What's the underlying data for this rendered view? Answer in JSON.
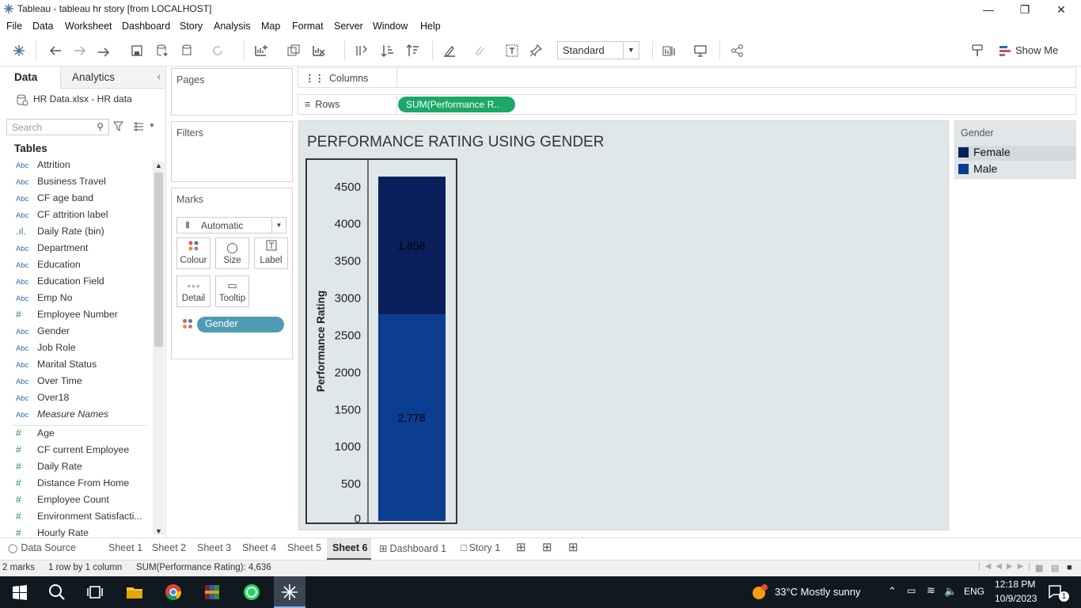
{
  "window": {
    "title": "Tableau - tableau hr story [from LOCALHOST]"
  },
  "menu": [
    "File",
    "Data",
    "Worksheet",
    "Dashboard",
    "Story",
    "Analysis",
    "Map",
    "Format",
    "Server",
    "Window",
    "Help"
  ],
  "toolbar": {
    "fit_mode": "Standard",
    "show_me": "Show Me"
  },
  "left": {
    "tabs": {
      "data": "Data",
      "analytics": "Analytics"
    },
    "datasource": "HR Data.xlsx - HR data",
    "search_placeholder": "Search",
    "tables_heading": "Tables",
    "fields": [
      {
        "type": "Abc",
        "name": "Attrition"
      },
      {
        "type": "Abc",
        "name": "Business Travel"
      },
      {
        "type": "Abc",
        "name": "CF age band"
      },
      {
        "type": "Abc",
        "name": "CF attrition label"
      },
      {
        "type": ".ıl.",
        "name": "Daily Rate (bin)"
      },
      {
        "type": "Abc",
        "name": "Department"
      },
      {
        "type": "Abc",
        "name": "Education"
      },
      {
        "type": "Abc",
        "name": "Education Field"
      },
      {
        "type": "Abc",
        "name": "Emp No"
      },
      {
        "type": "#",
        "name": "Employee Number"
      },
      {
        "type": "Abc",
        "name": "Gender"
      },
      {
        "type": "Abc",
        "name": "Job Role"
      },
      {
        "type": "Abc",
        "name": "Marital Status"
      },
      {
        "type": "Abc",
        "name": "Over Time"
      },
      {
        "type": "Abc",
        "name": "Over18"
      },
      {
        "type": "Abc",
        "name": "Measure Names"
      }
    ],
    "measures": [
      {
        "type": "#",
        "name": "Age"
      },
      {
        "type": "#",
        "name": "CF current Employee"
      },
      {
        "type": "#",
        "name": "Daily Rate"
      },
      {
        "type": "#",
        "name": "Distance From Home"
      },
      {
        "type": "#",
        "name": "Employee Count"
      },
      {
        "type": "#",
        "name": "Environment Satisfacti..."
      },
      {
        "type": "#",
        "name": "Hourly Rate"
      }
    ]
  },
  "cards": {
    "pages": "Pages",
    "filters": "Filters",
    "marks": "Marks",
    "mark_type": "Automatic",
    "mark_buttons": [
      "Colour",
      "Size",
      "Label",
      "Detail",
      "Tooltip"
    ],
    "color_pill": "Gender"
  },
  "shelves": {
    "columns_label": "Columns",
    "rows_label": "Rows",
    "rows_pill": "SUM(Performance R.."
  },
  "chart_data": {
    "type": "bar",
    "title": "PERFORMANCE RATING USING GENDER",
    "ylabel": "Performance Rating",
    "yticks": [
      0,
      500,
      1000,
      1500,
      2000,
      2500,
      3000,
      3500,
      4000,
      4500
    ],
    "ylim": [
      0,
      4850
    ],
    "stacked": true,
    "series": [
      {
        "name": "Male",
        "value": 2778,
        "label": "2,778",
        "color": "#0b3d91"
      },
      {
        "name": "Female",
        "value": 1858,
        "label": "1,858",
        "color": "#0a1f5c"
      }
    ]
  },
  "legend": {
    "title": "Gender",
    "items": [
      {
        "name": "Female",
        "color": "#0a1f5c"
      },
      {
        "name": "Male",
        "color": "#0b3d91"
      }
    ]
  },
  "sheet_tabs": [
    "Data Source",
    "Sheet 1",
    "Sheet 2",
    "Sheet 3",
    "Sheet 4",
    "Sheet 5",
    "Sheet 6",
    "Dashboard 1",
    "Story 1"
  ],
  "active_sheet": "Sheet 6",
  "status": {
    "marks": "2 marks",
    "dims": "1 row  by  1 column",
    "sum": "SUM(Performance Rating): 4,636"
  },
  "taskbar": {
    "weather": "33°C  Mostly sunny",
    "lang": "ENG",
    "time": "12:18 PM",
    "date": "10/9/2023",
    "notif": "1"
  }
}
